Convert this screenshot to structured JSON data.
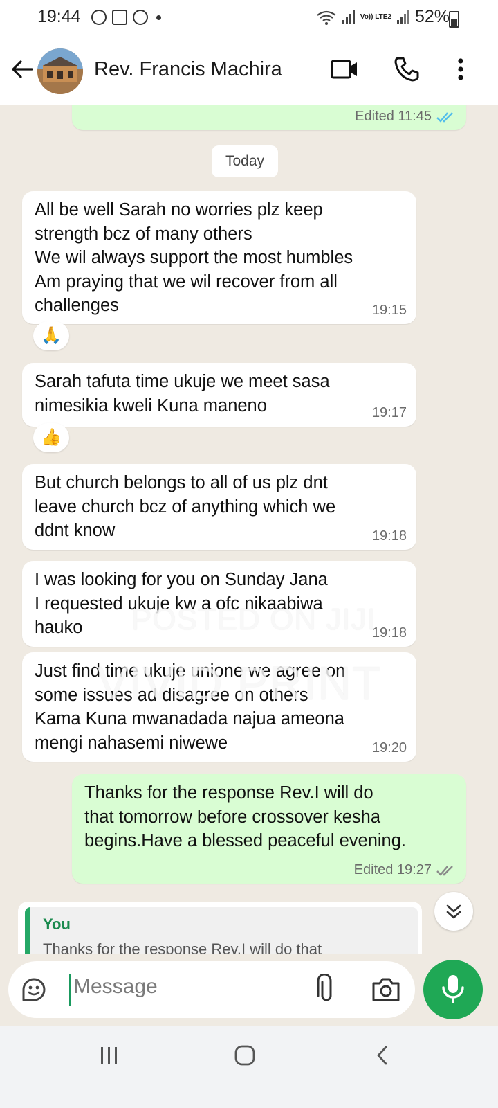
{
  "status_bar": {
    "time": "19:44",
    "network": "Vo)) LTE2",
    "battery": "52%"
  },
  "header": {
    "contact_name": "Rev. Francis Machira"
  },
  "chat": {
    "top_partial": {
      "meta": "Edited 11:45"
    },
    "date_chip": "Today",
    "messages": [
      {
        "text": "All be well Sarah no worries plz keep\nstrength bcz of many others\nWe wil always support the most humbles\nAm praying that we wil recover from all\nchallenges",
        "time": "19:15",
        "reaction": "🙏"
      },
      {
        "text": "Sarah tafuta time ukuje we meet sasa\nnimesikia kweli Kuna maneno",
        "time": "19:17",
        "reaction": "👍"
      },
      {
        "text": "But church belongs to all of us plz dnt\nleave church bcz of anything which we\nddnt know",
        "time": "19:18"
      },
      {
        "text": "I was looking for you on Sunday Jana\nI requested ukuje kw a ofc nikaabiwa\nhauko",
        "time": "19:18"
      },
      {
        "text": "Just find time ukuje unione we agree on\nsome issues ad disagree on others\nKama Kuna mwanadada najua ameona\nmengi nahasemi niwewe",
        "time": "19:20"
      }
    ],
    "outgoing": {
      "text": "Thanks for the response Rev.I will do\nthat tomorrow before crossover kesha\nbegins.Have a blessed peaceful evening.",
      "meta": "Edited 19:27"
    }
  },
  "watermarks": [
    "POSTED ON JIJI",
    "VIVID PRINT"
  ],
  "reply": {
    "author": "You",
    "text": "Thanks for the response Rev.I will do that"
  },
  "composer": {
    "placeholder": "Message"
  },
  "icons": [
    "back-arrow-icon",
    "video-call-icon",
    "phone-icon",
    "more-vert-icon",
    "double-check-icon",
    "sticker-icon",
    "attach-icon",
    "camera-icon",
    "mic-icon",
    "scroll-down-icon",
    "nav-recents-icon",
    "nav-home-icon",
    "nav-back-icon"
  ],
  "colors": {
    "outgoing_bubble": "#d9fdd3",
    "accent_green": "#1fa855",
    "read_ticks": "#53bdeb",
    "chat_bg": "#efeae2"
  }
}
